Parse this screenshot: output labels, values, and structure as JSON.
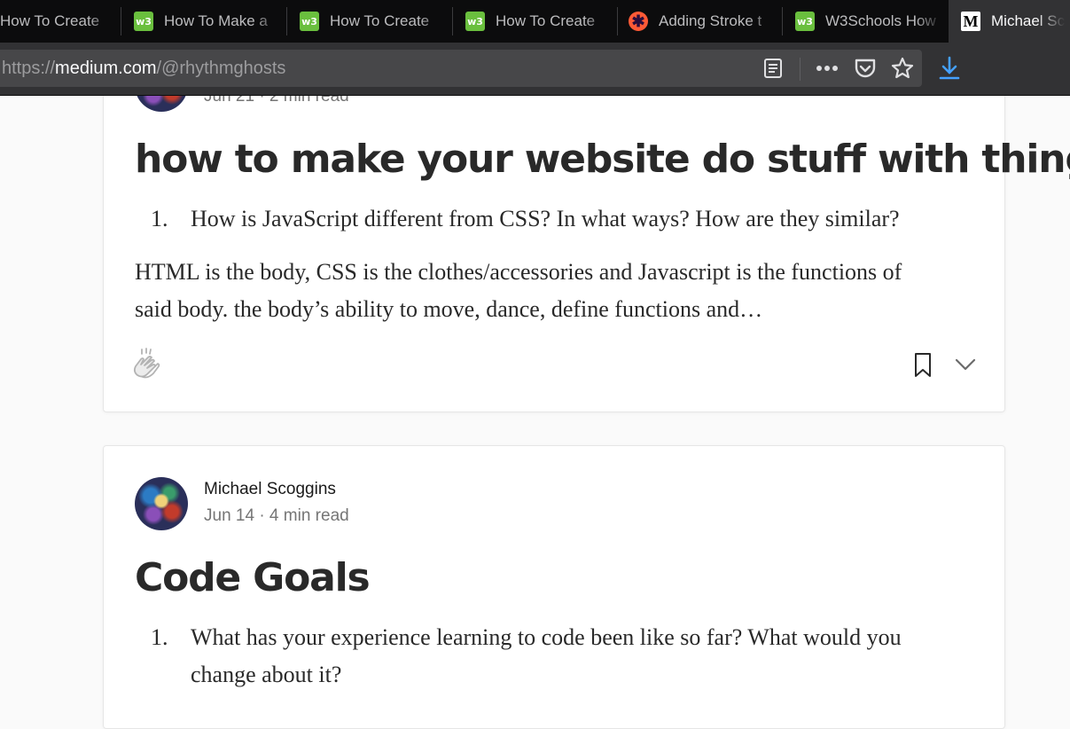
{
  "browser": {
    "tabs": [
      {
        "label": "How To Create",
        "favicon": "w3schools-favicon",
        "active": false
      },
      {
        "label": "How To Make a",
        "favicon": "w3schools-favicon",
        "active": false
      },
      {
        "label": "How To Create",
        "favicon": "w3schools-favicon",
        "active": false
      },
      {
        "label": "How To Create",
        "favicon": "w3schools-favicon",
        "active": false
      },
      {
        "label": "Adding Stroke t",
        "favicon": "asterisk-favicon",
        "active": false
      },
      {
        "label": "W3Schools How",
        "favicon": "w3schools-favicon",
        "active": false
      },
      {
        "label": "Michael Sco",
        "favicon": "medium-favicon",
        "active": true
      }
    ],
    "favicon_glyphs": {
      "w3": "w3",
      "star": "✱",
      "medium": "M"
    },
    "url": {
      "scheme": "https://",
      "host": "medium.com",
      "path": "/@rhythmghosts"
    },
    "toolbar_icons": [
      "reader-view-icon",
      "more-actions-icon",
      "pocket-icon",
      "bookmark-star-icon",
      "download-icon"
    ],
    "colors": {
      "download_accent": "#45a1ff",
      "tab_bar": "#0c0c0d",
      "nav_bar": "#323234"
    }
  },
  "posts": [
    {
      "meta": "Jun 21 · 2 min read",
      "title": "how to make your website do stuff with things",
      "list_number": "1.",
      "list_item": "How is JavaScript different from CSS? In what ways? How are they similar?",
      "excerpt_line1": "HTML is the body, CSS is the clothes/accessories and Javascript is the functions of",
      "excerpt_line2": "said body. the body’s ability to move, dance, define functions and…",
      "icons": [
        "clap-icon",
        "bookmark-icon",
        "chevron-down-icon"
      ]
    },
    {
      "author": "Michael Scoggins",
      "meta": "Jun 14 · 4 min read",
      "title": "Code Goals",
      "list_number": "1.",
      "list_item_line1": "What has your experience learning to code been like so far? What would you",
      "list_item_line2": "change about it?"
    }
  ]
}
